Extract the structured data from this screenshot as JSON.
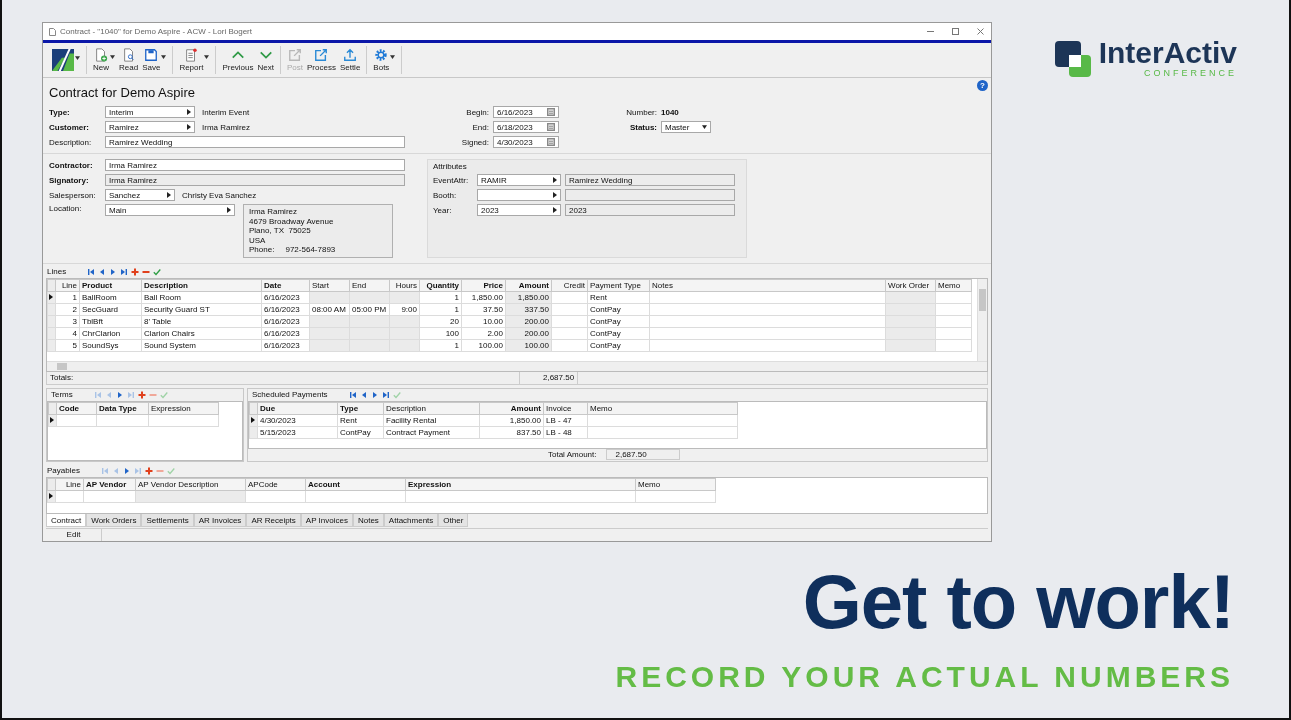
{
  "window": {
    "title": "Contract - \"1040\" for Demo Aspire - ACW - Lori Bogert"
  },
  "toolbar": [
    [
      {
        "kind": "logo",
        "dropdown": true,
        "disabled": false
      }
    ],
    [
      {
        "kind": "new",
        "label": "New",
        "dropdown": true,
        "disabled": false
      },
      {
        "kind": "read",
        "label": "Read",
        "dropdown": false,
        "disabled": false
      },
      {
        "kind": "save",
        "label": "Save",
        "dropdown": true,
        "disabled": false
      }
    ],
    [
      {
        "kind": "report",
        "label": "Report",
        "dropdown": true,
        "disabled": false
      }
    ],
    [
      {
        "kind": "previous",
        "label": "Previous",
        "dropdown": false,
        "disabled": false
      },
      {
        "kind": "next",
        "label": "Next",
        "dropdown": false,
        "disabled": false
      }
    ],
    [
      {
        "kind": "post",
        "label": "Post",
        "dropdown": false,
        "disabled": true
      },
      {
        "kind": "process",
        "label": "Process",
        "dropdown": false,
        "disabled": false
      },
      {
        "kind": "settle",
        "label": "Settle",
        "dropdown": false,
        "disabled": false
      }
    ],
    [
      {
        "kind": "bots",
        "label": "Bots",
        "dropdown": true,
        "disabled": false
      }
    ]
  ],
  "help": "?",
  "heading": "Contract for Demo Aspire",
  "header_fields": [
    {
      "label": "Type:",
      "bold": true,
      "kind": "dropdown",
      "value": "Interim",
      "note": "Interim Event"
    },
    {
      "label": "Customer:",
      "bold": true,
      "kind": "dropdown",
      "value": "Ramirez",
      "note": "Irma Ramirez"
    },
    {
      "label": "Description:",
      "bold": false,
      "kind": "text",
      "value": "Ramirez Wedding"
    }
  ],
  "dates": [
    {
      "label": "Begin:",
      "value": "6/16/2023"
    },
    {
      "label": "End:",
      "value": "6/18/2023"
    },
    {
      "label": "Signed:",
      "value": "4/30/2023"
    }
  ],
  "number": {
    "label": "Number:",
    "value": "1040"
  },
  "status": {
    "label": "Status:",
    "value": "Master"
  },
  "party_fields": [
    {
      "label": "Contractor:",
      "bold": true,
      "kind": "text",
      "value": "Irma Ramirez"
    },
    {
      "label": "Signatory:",
      "bold": true,
      "kind": "readonly",
      "value": "Irma Ramirez"
    },
    {
      "label": "Salesperson:",
      "bold": false,
      "kind": "dropdown",
      "value": "Sanchez",
      "note": "Christy Eva Sanchez"
    },
    {
      "label": "Location:",
      "bold": false,
      "kind": "dropdown",
      "value": "Main",
      "address": [
        "Irma Ramirez",
        "4679 Broadway Avenue",
        "Plano, TX  75025",
        "USA",
        "Phone:     972-564-7893"
      ]
    }
  ],
  "attributes": {
    "title": "Attributes",
    "rows": [
      {
        "label": "EventAttr:",
        "value": "RAMIR",
        "description": "Ramirez Wedding"
      },
      {
        "label": "Booth:"
      },
      {
        "label": "Year:",
        "value": "2023",
        "description": "2023"
      }
    ]
  },
  "lines": {
    "title": "Lines",
    "nav": [
      {
        "kind": "first",
        "disabled": false
      },
      {
        "kind": "prev",
        "disabled": false
      },
      {
        "kind": "next",
        "disabled": false
      },
      {
        "kind": "last",
        "disabled": false
      },
      {
        "kind": "add",
        "disabled": false
      },
      {
        "kind": "delete",
        "disabled": false
      },
      {
        "kind": "accept",
        "disabled": false
      }
    ],
    "columns": [
      {
        "label": "Line",
        "bold": false
      },
      {
        "label": "Product",
        "bold": true
      },
      {
        "label": "Description",
        "bold": true
      },
      {
        "label": "Date",
        "bold": true
      },
      {
        "label": "Start",
        "bold": false
      },
      {
        "label": "End",
        "bold": false
      },
      {
        "label": "Hours",
        "bold": false
      },
      {
        "label": "Quantity",
        "bold": true
      },
      {
        "label": "Price",
        "bold": true
      },
      {
        "label": "Amount",
        "bold": true
      },
      {
        "label": "Credit",
        "bold": false
      },
      {
        "label": "Payment Type",
        "bold": false
      },
      {
        "label": "Notes",
        "bold": false
      },
      {
        "label": "Work Order",
        "bold": false
      },
      {
        "label": "Memo",
        "bold": false
      }
    ],
    "rows": [
      {
        "current": true,
        "cells": [
          "1",
          "BallRoom",
          "Ball Room",
          "6/16/2023",
          null,
          null,
          null,
          "1",
          "1,850.00",
          "1,850.00",
          null,
          "Rent",
          null,
          null,
          null
        ]
      },
      {
        "current": false,
        "cells": [
          "2",
          "SecGuard",
          "Security Guard ST",
          "6/16/2023",
          "08:00 AM",
          "05:00 PM",
          "9:00",
          "1",
          "37.50",
          "337.50",
          null,
          "ContPay",
          null,
          null,
          null
        ]
      },
      {
        "current": false,
        "cells": [
          "3",
          "TblBft",
          "8' Table",
          "6/16/2023",
          null,
          null,
          null,
          "20",
          "10.00",
          "200.00",
          null,
          "ContPay",
          null,
          null,
          null
        ]
      },
      {
        "current": false,
        "cells": [
          "4",
          "ChrClarion",
          "Clarion Chairs",
          "6/16/2023",
          null,
          null,
          null,
          "100",
          "2.00",
          "200.00",
          null,
          "ContPay",
          null,
          null,
          null
        ]
      },
      {
        "current": false,
        "cells": [
          "5",
          "SoundSys",
          "Sound System",
          "6/16/2023",
          null,
          null,
          null,
          "1",
          "100.00",
          "100.00",
          null,
          "ContPay",
          null,
          null,
          null
        ]
      }
    ],
    "totals_label": "Totals:",
    "total": "2,687.50"
  },
  "terms": {
    "title": "Terms",
    "nav": [
      {
        "kind": "first",
        "disabled": true
      },
      {
        "kind": "prev",
        "disabled": true
      },
      {
        "kind": "next",
        "disabled": false
      },
      {
        "kind": "last",
        "disabled": true
      },
      {
        "kind": "add",
        "disabled": false
      },
      {
        "kind": "delete",
        "disabled": true
      },
      {
        "kind": "accept",
        "disabled": true
      }
    ],
    "columns": [
      {
        "label": "Code",
        "bold": true
      },
      {
        "label": "Data Type",
        "bold": true
      },
      {
        "label": "Expression",
        "bold": false
      }
    ],
    "blank_row_current": true
  },
  "scheduled_payments": {
    "title": "Scheduled Payments",
    "nav": [
      {
        "kind": "first",
        "disabled": false
      },
      {
        "kind": "prev",
        "disabled": false
      },
      {
        "kind": "next",
        "disabled": false
      },
      {
        "kind": "last",
        "disabled": false
      },
      {
        "kind": "accept",
        "disabled": true
      }
    ],
    "columns": [
      {
        "label": "Due",
        "bold": true
      },
      {
        "label": "Type",
        "bold": true
      },
      {
        "label": "Description",
        "bold": false
      },
      {
        "label": "Amount",
        "bold": true
      },
      {
        "label": "Invoice",
        "bold": false
      },
      {
        "label": "Memo",
        "bold": false
      }
    ],
    "rows": [
      {
        "current": true,
        "cells": [
          "4/30/2023",
          "Rent",
          "Facility Rental",
          "1,850.00",
          "LB - 47",
          null
        ]
      },
      {
        "current": false,
        "cells": [
          "5/15/2023",
          "ContPay",
          "Contract Payment",
          "837.50",
          "LB - 48",
          null
        ]
      }
    ],
    "total_label": "Total Amount:",
    "total": "2,687.50"
  },
  "payables": {
    "title": "Payables",
    "nav": [
      {
        "kind": "first",
        "disabled": true
      },
      {
        "kind": "prev",
        "disabled": true
      },
      {
        "kind": "next",
        "disabled": false
      },
      {
        "kind": "last",
        "disabled": true
      },
      {
        "kind": "add",
        "disabled": false
      },
      {
        "kind": "delete",
        "disabled": true
      },
      {
        "kind": "accept",
        "disabled": true
      }
    ],
    "columns": [
      {
        "label": "Line",
        "bold": false
      },
      {
        "label": "AP Vendor",
        "bold": true
      },
      {
        "label": "AP Vendor Description",
        "bold": false
      },
      {
        "label": "APCode",
        "bold": false
      },
      {
        "label": "Account",
        "bold": true
      },
      {
        "label": "Expression",
        "bold": true
      },
      {
        "label": "Memo",
        "bold": false
      }
    ],
    "blank_row_current": true
  },
  "tabs": [
    {
      "label": "Contract",
      "selected": true
    },
    {
      "label": "Work Orders",
      "selected": false
    },
    {
      "label": "Settlements",
      "selected": false
    },
    {
      "label": "AR Invoices",
      "selected": false
    },
    {
      "label": "AR Receipts",
      "selected": false
    },
    {
      "label": "AP Invoices",
      "selected": false
    },
    {
      "label": "Notes",
      "selected": false
    },
    {
      "label": "Attachments",
      "selected": false
    },
    {
      "label": "Other",
      "selected": false
    }
  ],
  "status_bar": {
    "mode": "Edit"
  },
  "brand": {
    "name": "InterActiv",
    "tagline": "CONFERENCE"
  },
  "headline": "Get to work!",
  "subtitle": "RECORD YOUR ACTUAL NUMBERS"
}
